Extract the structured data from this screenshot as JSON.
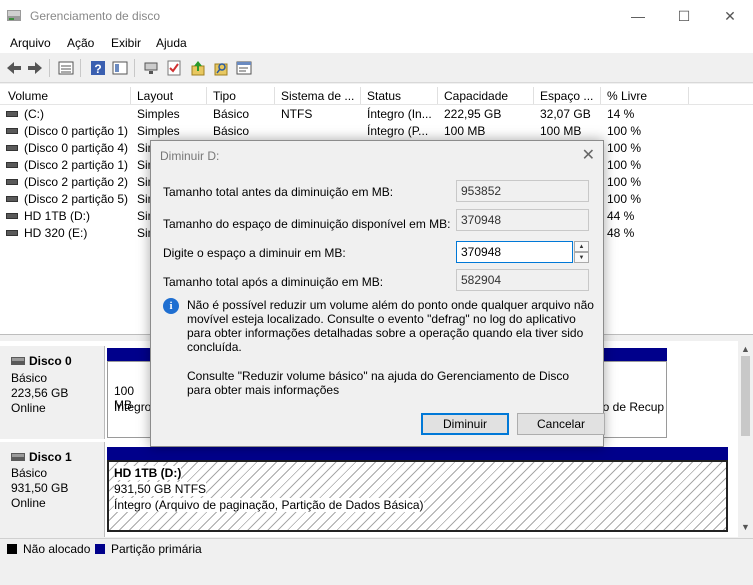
{
  "window": {
    "title": "Gerenciamento de disco",
    "minimize": "—",
    "maximize": "☐",
    "close": "✕"
  },
  "menu": [
    "Arquivo",
    "Ação",
    "Exibir",
    "Ajuda"
  ],
  "toolbar": [
    "back-icon",
    "forward-icon",
    "list-view-icon",
    "help-icon",
    "properties-icon",
    "connect-icon",
    "checklist-icon",
    "up-icon",
    "search-icon",
    "console-icon"
  ],
  "volume_list": {
    "columns": [
      "Volume",
      "Layout",
      "Tipo",
      "Sistema de ...",
      "Status",
      "Capacidade",
      "Espaço ...",
      "% Livre"
    ],
    "rows": [
      {
        "volume": "(C:)",
        "layout": "Simples",
        "tipo": "Básico",
        "sistema": "NTFS",
        "status": "Íntegro (In...",
        "capacidade": "222,95 GB",
        "espaco": "32,07 GB",
        "livre": "14 %"
      },
      {
        "volume": "(Disco 0 partição 1)",
        "layout": "Simples",
        "tipo": "Básico",
        "sistema": "",
        "status": "Íntegro (P...",
        "capacidade": "100 MB",
        "espaco": "100 MB",
        "livre": "100 %"
      },
      {
        "volume": "(Disco 0 partição 4)",
        "layout": "Sin",
        "tipo": "",
        "sistema": "",
        "status": "",
        "capacidade": "",
        "espaco": "",
        "livre": "100 %"
      },
      {
        "volume": "(Disco 2 partição 1)",
        "layout": "Sin",
        "tipo": "",
        "sistema": "",
        "status": "",
        "capacidade": "",
        "espaco": "",
        "livre": "100 %"
      },
      {
        "volume": "(Disco 2 partição 2)",
        "layout": "Sin",
        "tipo": "",
        "sistema": "",
        "status": "",
        "capacidade": "",
        "espaco": "",
        "livre": "100 %"
      },
      {
        "volume": "(Disco 2 partição 5)",
        "layout": "Sin",
        "tipo": "",
        "sistema": "",
        "status": "",
        "capacidade": "",
        "espaco": "",
        "livre": "100 %"
      },
      {
        "volume": "HD 1TB (D:)",
        "layout": "Sin",
        "tipo": "",
        "sistema": "",
        "status": "",
        "capacidade": "",
        "espaco": "",
        "livre": "44 %"
      },
      {
        "volume": "HD 320 (E:)",
        "layout": "Sin",
        "tipo": "",
        "sistema": "",
        "status": "",
        "capacidade": "",
        "espaco": "",
        "livre": "48 %"
      }
    ]
  },
  "disks": [
    {
      "name": "Disco 0",
      "type": "Básico",
      "size": "223,56 GB",
      "state": "Online",
      "part_left_line1": "100 MB",
      "part_left_line2": "Íntegro",
      "part_right": "io de Recup"
    },
    {
      "name": "Disco 1",
      "type": "Básico",
      "size": "931,50 GB",
      "state": "Online",
      "part_title": "HD 1TB  (D:)",
      "part_size": "931,50 GB NTFS",
      "part_status": "Íntegro (Arquivo de paginação, Partição de Dados Básica)"
    }
  ],
  "legend": {
    "unallocated": "Não alocado",
    "unallocated_color": "#000000",
    "primary": "Partição primária",
    "primary_color": "#00008b"
  },
  "dialog": {
    "title": "Diminuir D:",
    "total_before_label": "Tamanho total antes da diminuição em MB:",
    "total_before_value": "953852",
    "available_label": "Tamanho do espaço de diminuição disponível em MB:",
    "available_value": "370948",
    "input_label": "Digite o espaço a diminuir em MB:",
    "input_value": "370948",
    "total_after_label": "Tamanho total após a diminuição em MB:",
    "total_after_value": "582904",
    "info_text": "Não é possível reduzir um volume além do ponto onde qualquer arquivo não movível esteja localizado. Consulte o evento \"defrag\" no log do aplicativo para obter informações detalhadas sobre a operação quando ela tiver sido concluída.",
    "consult_text": "Consulte \"Reduzir volume básico\" na ajuda do Gerenciamento de Disco para obter mais informações",
    "ok_label": "Diminuir",
    "cancel_label": "Cancelar"
  }
}
